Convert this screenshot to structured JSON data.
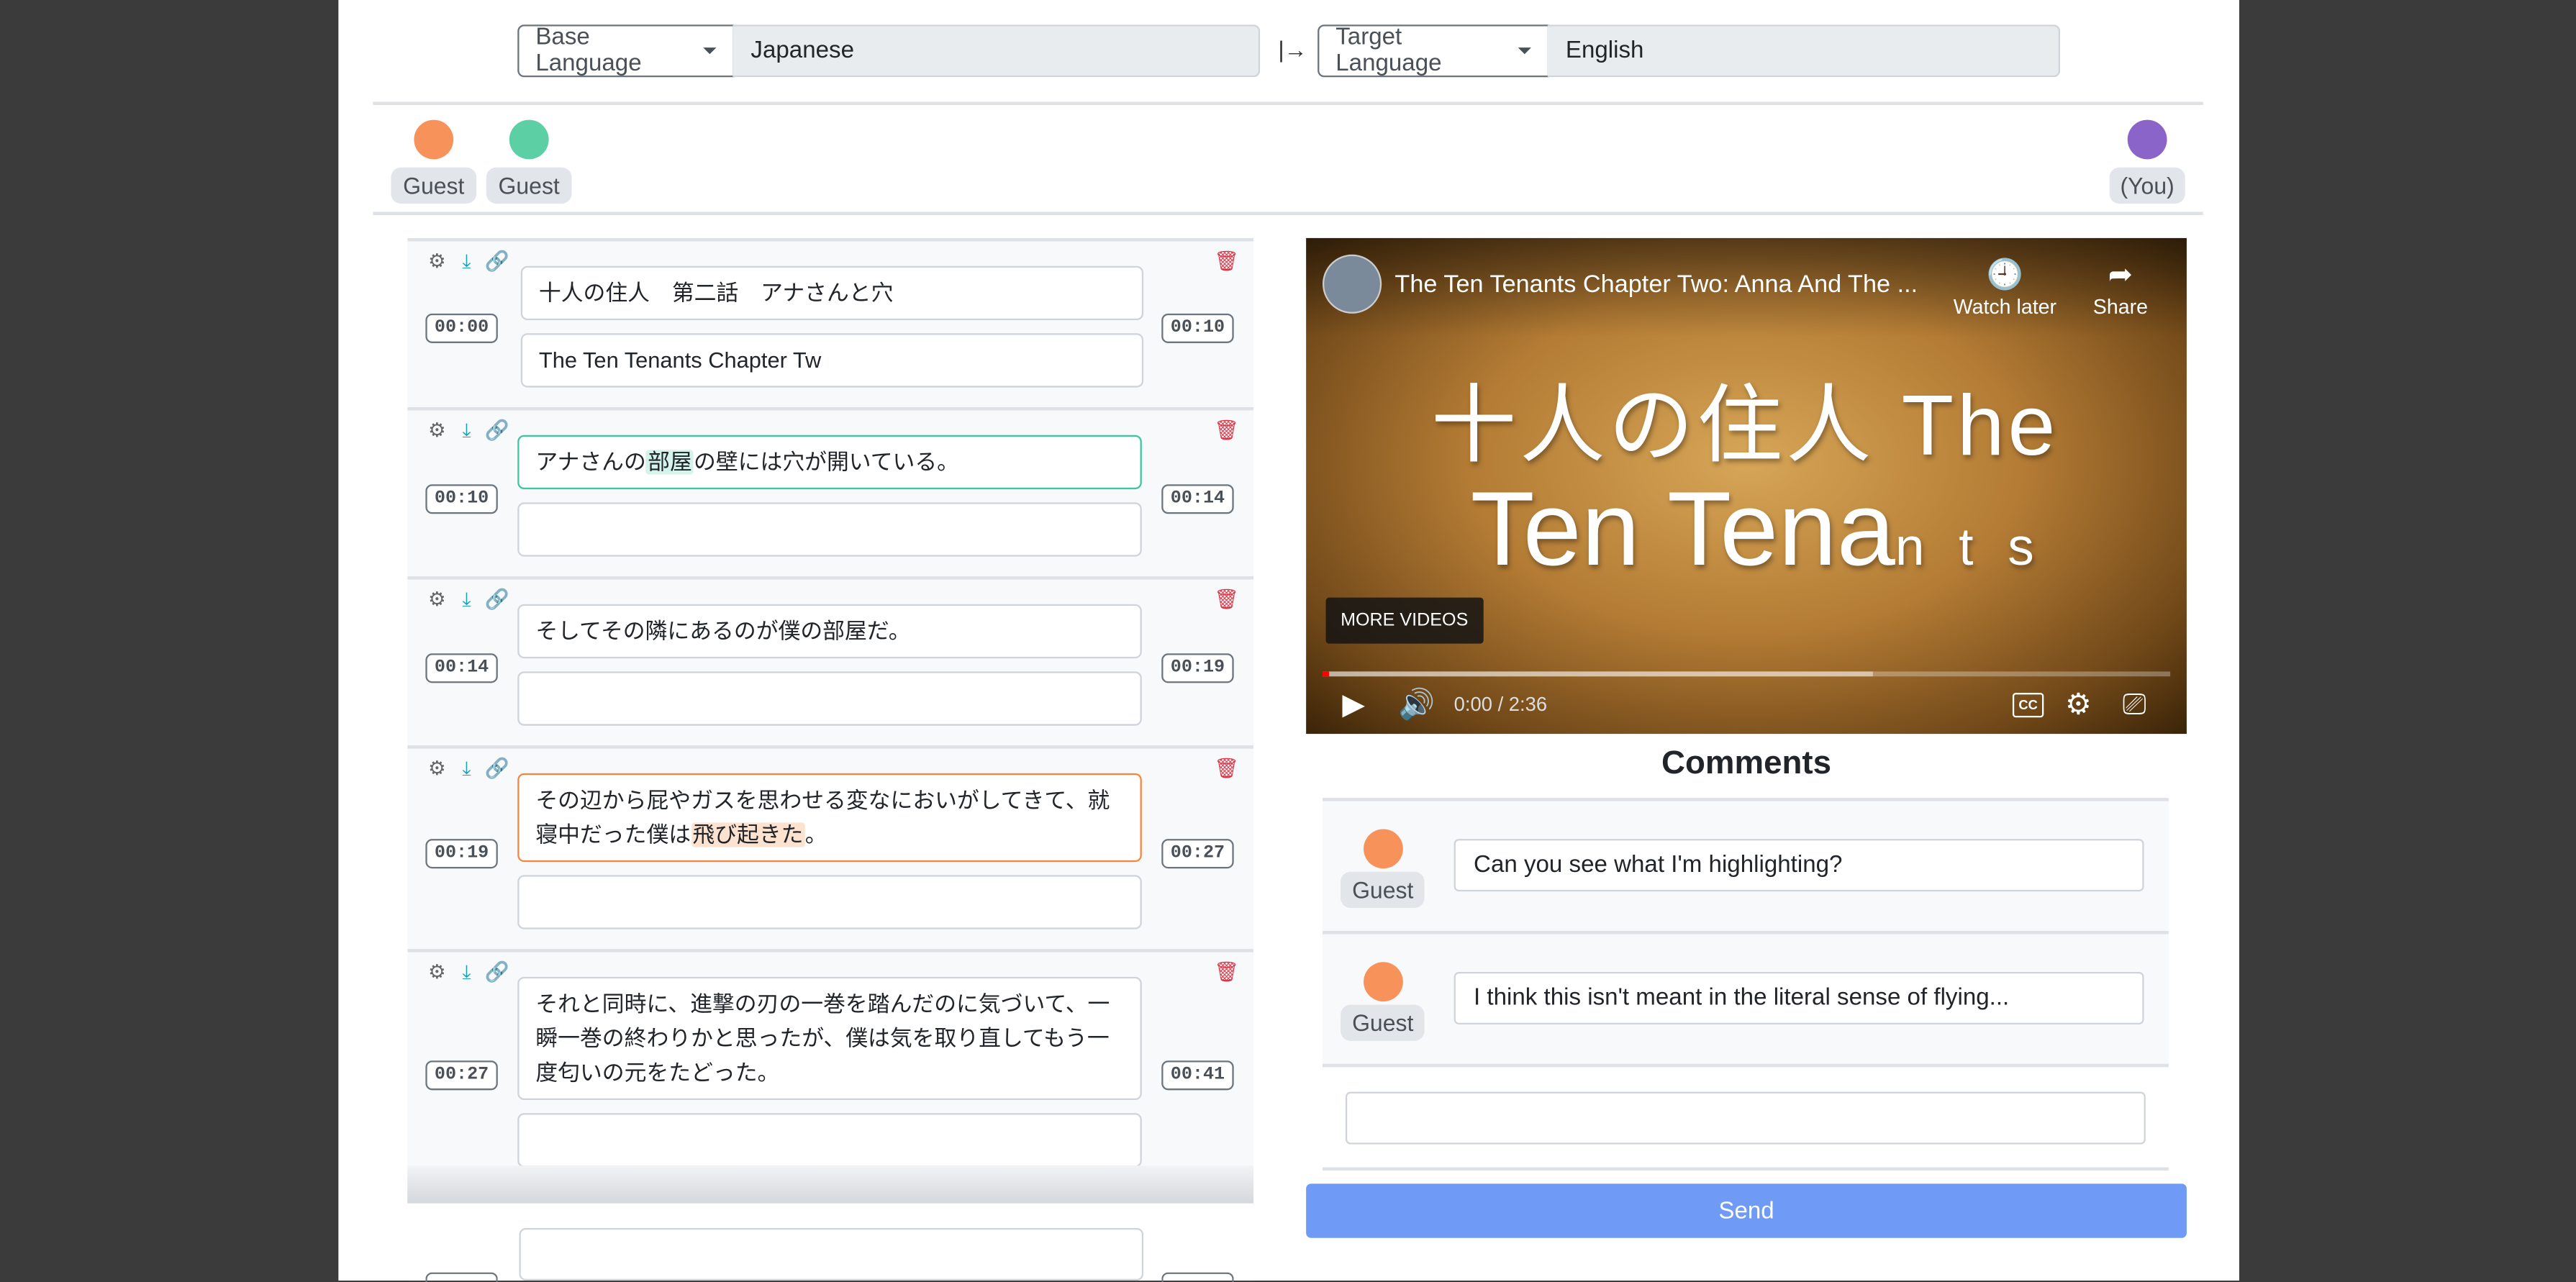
{
  "language_bar": {
    "base_button": "Base Language",
    "base_value": "Japanese",
    "arrow": "|→",
    "target_button": "Target Language",
    "target_value": "English"
  },
  "participants": {
    "left": [
      {
        "label": "Guest",
        "color": "#f7935a"
      },
      {
        "label": "Guest",
        "color": "#5ccfa4"
      }
    ],
    "right": {
      "label": "(You)",
      "color": "#8a64c9"
    }
  },
  "subtitles": [
    {
      "start": "00:00",
      "end": "00:10",
      "text": "十人の住人　第二話　アナさんと穴",
      "translation": "The Ten Tenants Chapter Tw"
    },
    {
      "start": "00:10",
      "end": "00:14",
      "text_pre": "アナさんの",
      "text_hl": "部屋",
      "text_post": "の壁には穴が開いている。",
      "translation": ""
    },
    {
      "start": "00:14",
      "end": "00:19",
      "text": "そしてその隣にあるのが僕の部屋だ。",
      "translation": ""
    },
    {
      "start": "00:19",
      "end": "00:27",
      "text_pre": "その辺から屁やガスを思わせる変なにおいがしてきて、就寝中だった僕は",
      "text_hl": "飛び起きた",
      "text_post": "。",
      "translation": ""
    },
    {
      "start": "00:27",
      "end": "00:41",
      "text": "それと同時に、進撃の刃の一巻を踏んだのに気づいて、一瞬一巻の終わりかと思ったが、僕は気を取り直してもう一度匂いの元をたどった。",
      "translation": ""
    }
  ],
  "video": {
    "title": "The Ten Tenants Chapter Two: Anna And The ...",
    "watch_later": "Watch later",
    "share": "Share",
    "big_line1": "十人の住人 The",
    "big_line2_a": "Ten Tena",
    "big_line2_b": "n t s",
    "more_videos": "MORE VIDEOS",
    "time": "0:00 / 2:36",
    "cc": "CC",
    "buffered_fraction": 0.65,
    "played_fraction": 0.0
  },
  "comments": {
    "title": "Comments",
    "items": [
      {
        "author": "Guest",
        "color": "#f7935a",
        "text": "Can you see what I'm highlighting?"
      },
      {
        "author": "Guest",
        "color": "#f7935a",
        "text": "I think this isn't meant in the literal sense of flying..."
      }
    ],
    "input_value": "",
    "send": "Send"
  }
}
